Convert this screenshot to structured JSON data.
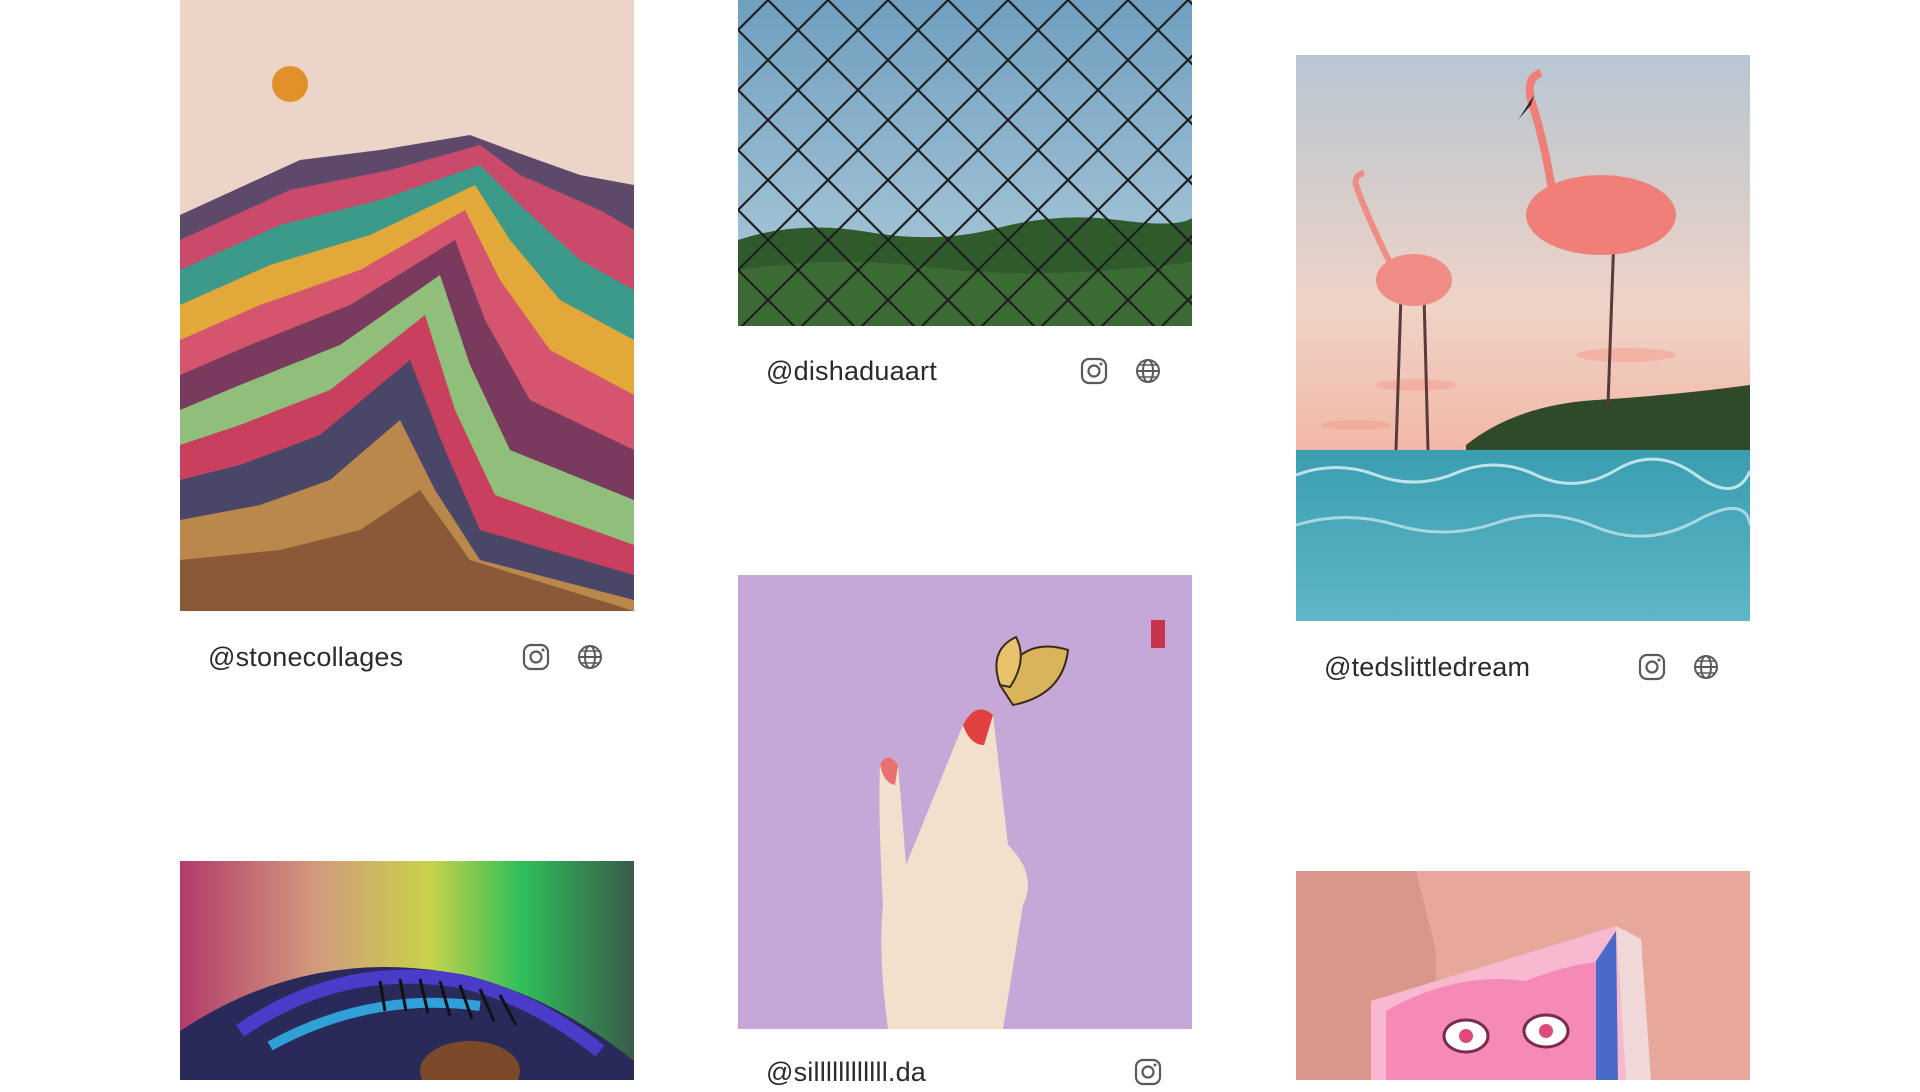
{
  "gallery": {
    "cards": [
      {
        "id": "stonecollages",
        "handle": "@stonecollages",
        "artwork": "rainbow-mountain-collage",
        "links": [
          "instagram-icon",
          "globe-icon"
        ]
      },
      {
        "id": "dishaduaart",
        "handle": "@dishaduaart",
        "artwork": "chain-link-fence-over-hills",
        "links": [
          "instagram-icon",
          "globe-icon"
        ]
      },
      {
        "id": "tedslittledream",
        "handle": "@tedslittledream",
        "artwork": "flamingos-with-cloud-bodies-over-sea",
        "links": [
          "instagram-icon",
          "globe-icon"
        ]
      },
      {
        "id": "sillll-da",
        "handle": "@sillllllllllll.da",
        "artwork": "finger-with-butterfly-on-lilac",
        "links": [
          "instagram-icon"
        ]
      },
      {
        "id": "rainbow-eye",
        "handle": "",
        "artwork": "rainbow-eyelid-closeup",
        "links": []
      },
      {
        "id": "anime-box",
        "handle": "",
        "artwork": "pink-hair-anime-box-in-pink-room",
        "links": []
      }
    ]
  },
  "colors": {
    "background": "#ffffff",
    "handle_text": "#2b2b2b",
    "icon_stroke": "#5a5a5a"
  }
}
